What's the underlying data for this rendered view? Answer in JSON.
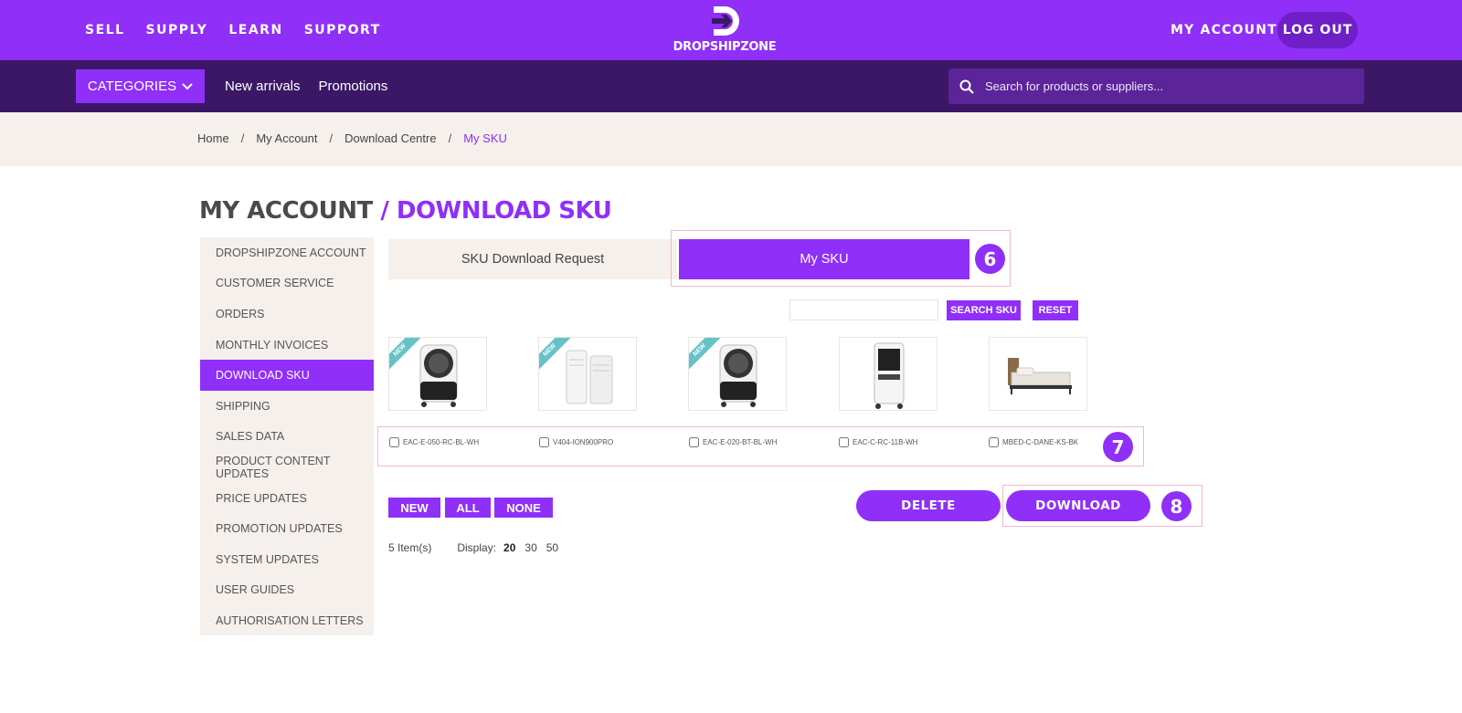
{
  "header": {
    "nav": [
      "SELL",
      "SUPPLY",
      "LEARN",
      "SUPPORT"
    ],
    "logo_text": "DROPSHIPZONE",
    "my_account": "MY ACCOUNT",
    "logout": "LOG OUT"
  },
  "subnav": {
    "categories": "CATEGORIES",
    "links": [
      "New arrivals",
      "Promotions"
    ],
    "search_placeholder": "Search for products or suppliers..."
  },
  "breadcrumb": {
    "items": [
      "Home",
      "My Account",
      "Download Centre"
    ],
    "current": "My SKU",
    "separator": "/"
  },
  "title": {
    "part1": "MY ACCOUNT",
    "part2": "/ DOWNLOAD SKU"
  },
  "sidebar": {
    "items": [
      "DROPSHIPZONE ACCOUNT",
      "CUSTOMER SERVICE",
      "ORDERS",
      "MONTHLY INVOICES",
      "DOWNLOAD SKU",
      "SHIPPING",
      "SALES DATA",
      "PRODUCT CONTENT UPDATES",
      "PRICE UPDATES",
      "PROMOTION UPDATES",
      "SYSTEM UPDATES",
      "USER GUIDES",
      "AUTHORISATION LETTERS"
    ],
    "active_index": 4
  },
  "tabs": {
    "request": "SKU Download Request",
    "my_sku": "My SKU"
  },
  "sku_search": {
    "value": "",
    "search_btn": "SEARCH SKU",
    "reset_btn": "RESET"
  },
  "products": [
    {
      "sku": "EAC-E-050-RC-BL-WH",
      "ribbon": "NEW",
      "icon": "evaporative-cooler-icon"
    },
    {
      "sku": "V404-ION900PRO",
      "ribbon": "NEW",
      "icon": "air-purifier-icon"
    },
    {
      "sku": "EAC-E-020-BT-BL-WH",
      "ribbon": "NEW",
      "icon": "evaporative-cooler-icon"
    },
    {
      "sku": "EAC-C-RC-11B-WH",
      "ribbon": "",
      "icon": "tower-cooler-icon"
    },
    {
      "sku": "MBED-C-DANE-KS-BK",
      "ribbon": "",
      "icon": "bed-frame-icon"
    }
  ],
  "filters": [
    "NEW",
    "ALL",
    "NONE"
  ],
  "actions": {
    "delete": "DELETE",
    "download": "DOWNLOAD"
  },
  "pagination": {
    "count": "5 Item(s)",
    "display_label": "Display:",
    "options": [
      "20",
      "30",
      "50"
    ],
    "selected": "20"
  },
  "annotations": [
    "6",
    "7",
    "8"
  ],
  "colors": {
    "primary": "#8f2ff7",
    "dark": "#3b1766",
    "beige": "#f5f0ec",
    "highlight": "#f3b8d2"
  }
}
